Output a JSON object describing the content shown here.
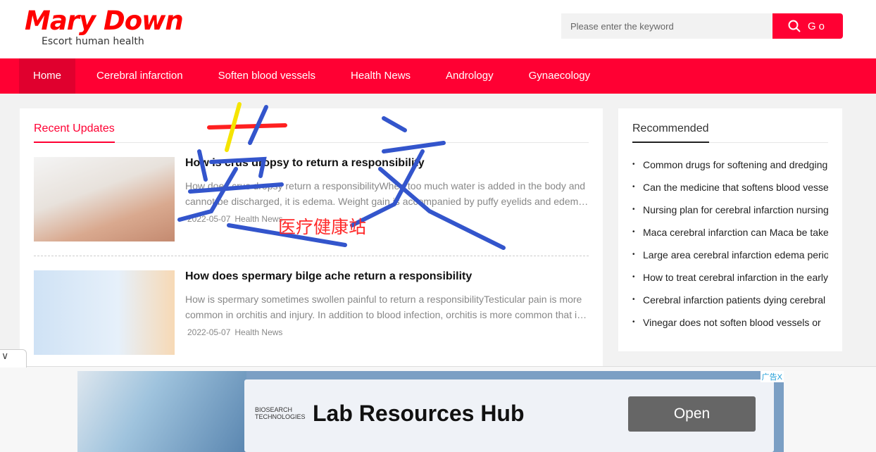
{
  "logo": {
    "title": "Mary Down",
    "subtitle": "Escort human health"
  },
  "search": {
    "placeholder": "Please enter the keyword",
    "button": "Go",
    "icon": "search-icon"
  },
  "nav": [
    "Home",
    "Cerebral infarction",
    "Soften blood vessels",
    "Health News",
    "Andrology",
    "Gynaecology"
  ],
  "accent": "#ff0033",
  "recent": {
    "title": "Recent Updates",
    "articles": [
      {
        "title": "How is crus dropsy to return a responsibility",
        "summary": "How does crus dropsy return a responsibilityWhen too much water is added in the body and cannot be discharged, it is edema. Weight gain is accompanied by puffy eyelids and edema of the lower limbs.",
        "date": "2022-05-07",
        "category": "Health News"
      },
      {
        "title": "How does spermary bilge ache return a responsibility",
        "summary": "How is spermary sometimes swollen painful to return a responsibilityTesticular pain is more common in orchitis and injury. In addition to blood infection, orchitis is more common that is caused by infection.",
        "date": "2022-05-07",
        "category": "Health News"
      }
    ]
  },
  "recommended": {
    "title": "Recommended",
    "items": [
      "Common drugs for softening and dredging blood vessels",
      "Can the medicine that softens blood vessels",
      "Nursing plan for cerebral infarction nursing",
      "Maca cerebral infarction can Maca be taken",
      "Large area cerebral infarction edema period",
      "How to treat cerebral infarction in the early",
      "Cerebral infarction patients dying cerebral",
      "Vinegar does not soften blood vessels or"
    ]
  },
  "ad": {
    "brand": "BIOSEARCH TECHNOLOGIES",
    "headline": "Lab Resources Hub",
    "button": "Open",
    "label": "广告X"
  },
  "watermark": "医疗健康站"
}
